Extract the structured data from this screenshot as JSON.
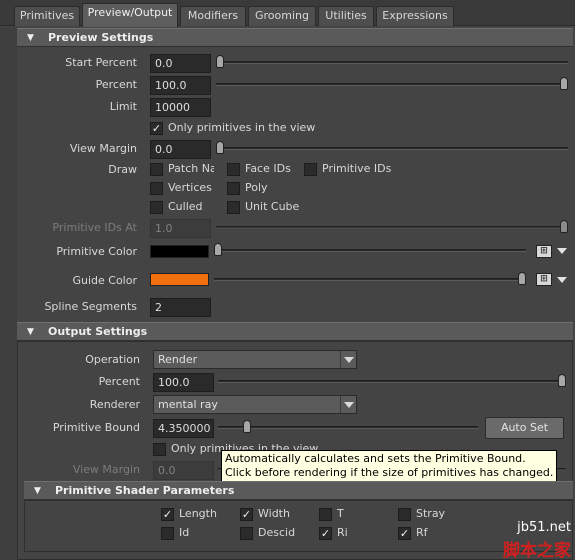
{
  "tabs": [
    "Primitives",
    "Preview/Output",
    "Modifiers",
    "Grooming",
    "Utilities",
    "Expressions"
  ],
  "preview": {
    "title": "Preview Settings",
    "start_percent": {
      "label": "Start Percent",
      "value": "0.0",
      "level": 0.0
    },
    "percent": {
      "label": "Percent",
      "value": "100.0",
      "level": 1.0
    },
    "limit": {
      "label": "Limit",
      "value": "10000"
    },
    "only_in_view": {
      "label": "Only primitives in the view",
      "checked": true
    },
    "view_margin": {
      "label": "View Margin",
      "value": "0.0",
      "level": 0.0
    },
    "draw_label": "Draw",
    "draw_options": {
      "patch_names": {
        "label": "Patch Nar",
        "checked": false
      },
      "face_ids": {
        "label": "Face IDs",
        "checked": false
      },
      "primitive_ids": {
        "label": "Primitive IDs",
        "checked": false
      },
      "vertices": {
        "label": "Vertices",
        "checked": false
      },
      "poly": {
        "label": "Poly",
        "checked": false
      },
      "culled": {
        "label": "Culled",
        "checked": false
      },
      "unit_cube": {
        "label": "Unit Cube",
        "checked": false
      }
    },
    "primitive_ids_at": {
      "label": "Primitive IDs At",
      "value": "1.0",
      "level": 1.0
    },
    "primitive_color": {
      "label": "Primitive Color",
      "color": "#000000",
      "level": 0.0
    },
    "guide_color": {
      "label": "Guide Color",
      "color": "#f07010",
      "level": 1.0
    },
    "spline_segments": {
      "label": "Spline Segments",
      "value": "2"
    }
  },
  "output": {
    "title": "Output Settings",
    "operation": {
      "label": "Operation",
      "value": "Render"
    },
    "percent": {
      "label": "Percent",
      "value": "100.0",
      "level": 1.0
    },
    "renderer": {
      "label": "Renderer",
      "value": "mental ray"
    },
    "primitive_bound": {
      "label": "Primitive Bound",
      "value": "4.350000",
      "level": 0.1
    },
    "auto_set_label": "Auto Set",
    "only_in_view": {
      "label": "Only primitives in the view",
      "checked": false
    },
    "view_margin": {
      "label": "View Margin",
      "value": "0.0"
    }
  },
  "tooltip": {
    "line1": "Automatically calculates and sets the Primitive Bound.",
    "line2": "Click before rendering if the size of primitives has changed."
  },
  "shader": {
    "title": "Primitive Shader Parameters",
    "params": {
      "length": {
        "label": "Length",
        "checked": true
      },
      "width": {
        "label": "Width",
        "checked": true
      },
      "t": {
        "label": "T",
        "checked": false
      },
      "stray": {
        "label": "Stray",
        "checked": false
      },
      "id": {
        "label": "Id",
        "checked": false
      },
      "descid": {
        "label": "Descid",
        "checked": false
      },
      "ri": {
        "label": "Ri",
        "checked": true
      },
      "rf": {
        "label": "Rf",
        "checked": true
      }
    }
  },
  "watermark": {
    "site": "jb51.net",
    "name": "脚本之家"
  },
  "icons": {
    "check": "✓",
    "collapse": "▼",
    "map_button": "map-icon"
  }
}
